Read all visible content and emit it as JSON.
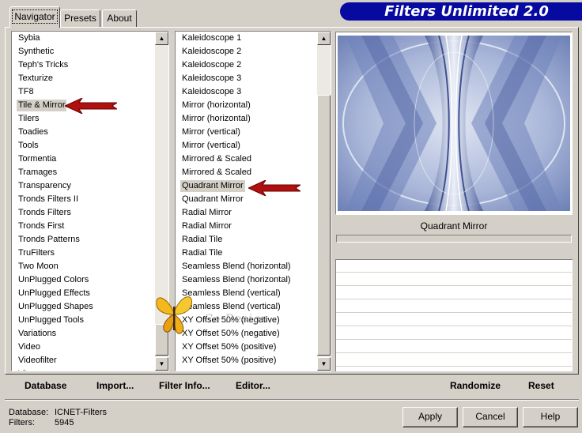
{
  "tabs": [
    {
      "label": "Navigator",
      "active": true
    },
    {
      "label": "Presets",
      "active": false
    },
    {
      "label": "About",
      "active": false
    }
  ],
  "title": "Filters Unlimited 2.0",
  "categories": {
    "items": [
      "Sybia",
      "Synthetic",
      "Teph's Tricks",
      "Texturize",
      "TF8",
      "Tile & Mirror",
      "Tilers",
      "Toadies",
      "Tools",
      "Tormentia",
      "Tramages",
      "Transparency",
      "Tronds Filters II",
      "Tronds Filters",
      "Tronds First",
      "Tronds Patterns",
      "TruFilters",
      "Two Moon",
      "UnPlugged Colors",
      "UnPlugged Effects",
      "UnPlugged Shapes",
      "UnPlugged Tools",
      "Variations",
      "Video",
      "Videofilter",
      "Vi..."
    ],
    "selected_index": 5
  },
  "filters": {
    "items": [
      "Kaleidoscope 1",
      "Kaleidoscope 2",
      "Kaleidoscope 2",
      "Kaleidoscope 3",
      "Kaleidoscope 3",
      "Mirror (horizontal)",
      "Mirror (horizontal)",
      "Mirror (vertical)",
      "Mirror (vertical)",
      "Mirrored & Scaled",
      "Mirrored & Scaled",
      "Quadrant Mirror",
      "Quadrant Mirror",
      "Radial Mirror",
      "Radial Mirror",
      "Radial Tile",
      "Radial Tile",
      "Seamless Blend (horizontal)",
      "Seamless Blend (horizontal)",
      "Seamless Blend (vertical)",
      "Seamless Blend (vertical)",
      "XY Offset 50% (negative)",
      "XY Offset 50% (negative)",
      "XY Offset 50% (positive)",
      "XY Offset 50% (positive)"
    ],
    "selected_index": 11
  },
  "preview": {
    "caption": "Quadrant Mirror",
    "progress_percent": 0
  },
  "watermark_text": "Co Design",
  "toolbar": {
    "database": "Database",
    "import": "Import...",
    "filter_info": "Filter Info...",
    "editor": "Editor...",
    "randomize": "Randomize",
    "reset": "Reset"
  },
  "info": {
    "database_label": "Database:",
    "database_value": "ICNET-Filters",
    "filters_label": "Filters:",
    "filters_value": "5945"
  },
  "buttons": {
    "apply": "Apply",
    "cancel": "Cancel",
    "help": "Help"
  },
  "colors": {
    "banner": "#060aa0",
    "arrow": "#b01010",
    "preview_blue": "#8d9dc8"
  }
}
